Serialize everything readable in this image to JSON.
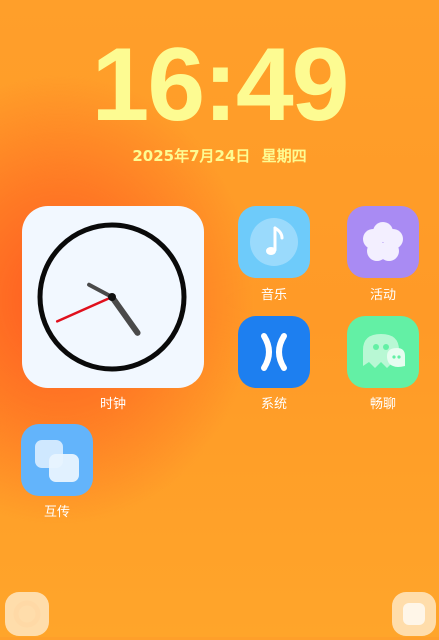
{
  "lockscreen": {
    "time": "16:49",
    "date": "2025年7月24日",
    "weekday": "星期四"
  },
  "widgets": {
    "clock": {
      "label": "时钟",
      "hour": 16,
      "minute": 49,
      "second": 41
    }
  },
  "apps": [
    {
      "label": "音乐",
      "icon": "music-note-icon",
      "color": "#6ecbfa"
    },
    {
      "label": "活动",
      "icon": "flower-icon",
      "color": "#a98bf3"
    },
    {
      "label": "系统",
      "icon": "x-cross-icon",
      "color": "#1d7ff0"
    },
    {
      "label": "畅聊",
      "icon": "chat-ghost-icon",
      "color": "#63f0a5"
    },
    {
      "label": "互传",
      "icon": "share-squares-icon",
      "color": "#63b4fb"
    }
  ],
  "colors": {
    "accent_text": "#fdfb92",
    "background_top": "#ff9f2a",
    "background_glow": "#ff5a22",
    "second_hand": "#e0101d"
  }
}
